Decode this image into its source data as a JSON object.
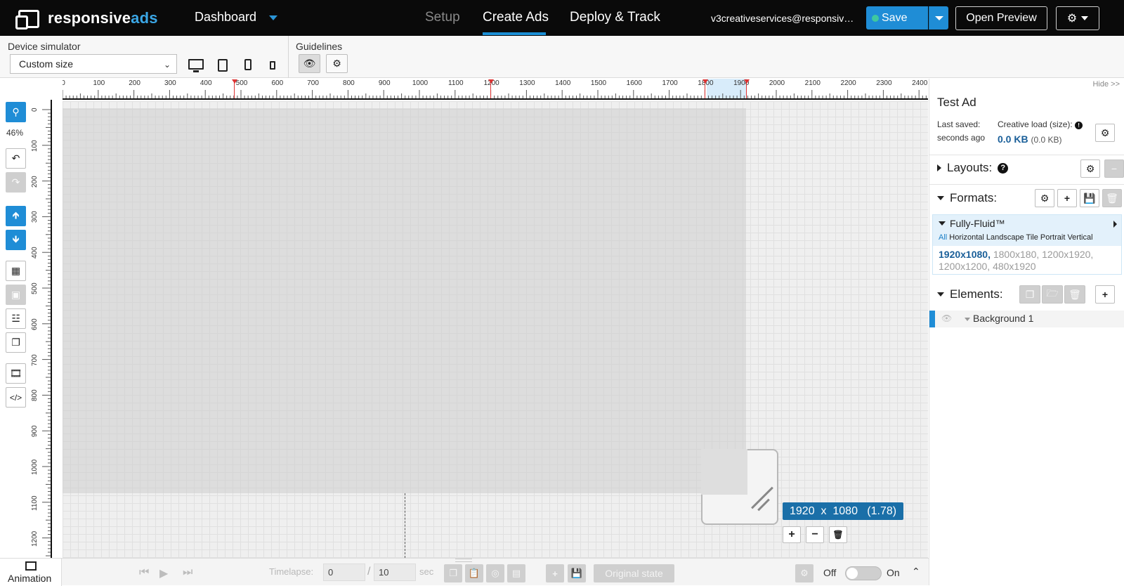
{
  "brand": {
    "logo_main": "responsive",
    "logo_accent": "ads"
  },
  "nav": {
    "dashboard": "Dashboard",
    "tabs": [
      "Setup",
      "Create Ads",
      "Deploy & Track"
    ]
  },
  "account": {
    "email": "v3creativeservices@responsivea..."
  },
  "header_actions": {
    "save": "Save",
    "open_preview": "Open Preview"
  },
  "toolbar": {
    "device_simulator_label": "Device simulator",
    "device_select_value": "Custom size",
    "guidelines_label": "Guidelines"
  },
  "left_tools": {
    "zoom": "46%"
  },
  "ruler": {
    "top_ticks": [
      "0",
      "100",
      "200",
      "300",
      "400",
      "500",
      "600",
      "700",
      "800",
      "900",
      "1000",
      "1100",
      "1200",
      "1300",
      "1400",
      "1500",
      "1600",
      "1700",
      "1800",
      "1900",
      "2000",
      "2100",
      "2200",
      "2300",
      "2400"
    ],
    "left_ticks": [
      "0",
      "100",
      "200",
      "300",
      "400",
      "500",
      "600",
      "700",
      "800",
      "900",
      "1000",
      "1100",
      "1200"
    ]
  },
  "canvas": {
    "size_badge": "1920  x  1080   (1.78)"
  },
  "right_panel": {
    "hide_link": "Hide >>",
    "ad_title": "Test Ad",
    "last_saved_label": "Last saved:",
    "last_saved_value": "seconds ago",
    "creative_load_label": "Creative load (size):",
    "creative_load_value": "0.0 KB",
    "creative_load_sub": "(0.0 KB)",
    "layouts_label": "Layouts:",
    "formats_label": "Formats:",
    "format": {
      "name": "Fully-Fluid™",
      "filter_all": "All",
      "filters": "Horizontal Landscape Tile Portrait Vertical",
      "active_size": "1920x1080,",
      "other_sizes": "1800x180, 1200x1920, 1200x1200, 480x1920"
    },
    "elements_label": "Elements:",
    "elements": [
      {
        "name": "Background 1"
      }
    ]
  },
  "bottom_bar": {
    "animation_label": "Animation",
    "timelapse_label": "Timelapse:",
    "timelapse_value": "0",
    "timelapse_total": "10",
    "timelapse_unit": "sec",
    "original_state": "Original state",
    "toggle_off": "Off",
    "toggle_on": "On"
  },
  "colors": {
    "accent": "#1f8dd6",
    "header_bg": "#0a0a0a",
    "size_badge": "#1a6fa8",
    "save_dot": "#3ec8a0"
  }
}
